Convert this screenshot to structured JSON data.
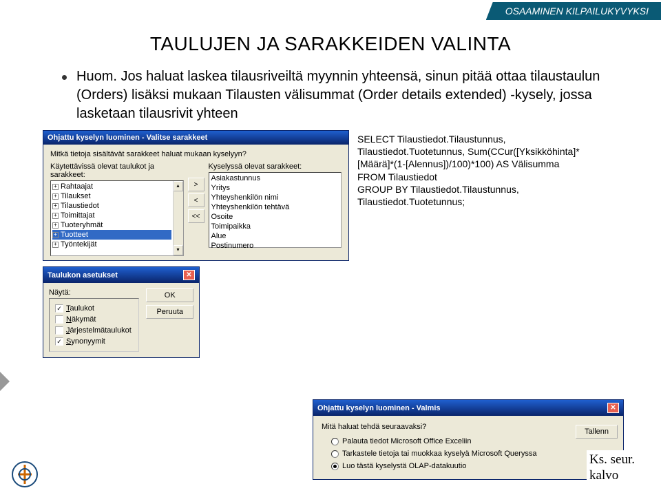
{
  "banner": "OSAAMINEN KILPAILUKYVYKSI",
  "title": "TAULUJEN JA SARAKKEIDEN VALINTA",
  "bullet": "Huom. Jos haluat laskea tilausriveiltä myynnin yhteensä, sinun pitää ottaa tilaustaulun (Orders) lisäksi mukaan Tilausten välisummat (Order details extended) -kysely, jossa lasketaan tilausrivit yhteen",
  "wizard1": {
    "title": "Ohjattu kyselyn luominen - Valitse sarakkeet",
    "desc": "Mitkä tietoja sisältävät sarakkeet haluat mukaan kyselyyn?",
    "leftLabel": "Käytettävissä olevat taulukot ja sarakkeet:",
    "rightLabel": "Kyselyssä olevat sarakkeet:",
    "leftItems": [
      "Rahtaajat",
      "Tilaukset",
      "Tilaustiedot",
      "Toimittajat",
      "Tuoteryhmät",
      "Tuotteet",
      "Työntekijät"
    ],
    "selectedLeft": "Tuotteet",
    "rightItems": [
      "Asiakastunnus",
      "Yritys",
      "Yhteyshenkilön nimi",
      "Yhteyshenkilön tehtävä",
      "Osoite",
      "Toimipaikka",
      "Alue",
      "Postinumero"
    ]
  },
  "dlg2": {
    "title": "Taulukon asetukset",
    "groupLabel": "Näytä:",
    "checks": [
      {
        "label": "Taulukot",
        "checked": true
      },
      {
        "label": "Näkymät",
        "checked": false
      },
      {
        "label": "Järjestelmätaulukot",
        "checked": false
      },
      {
        "label": "Synonyymit",
        "checked": true
      }
    ],
    "ok": "OK",
    "cancel": "Peruuta"
  },
  "sql": "SELECT Tilaustiedot.Tilaustunnus, Tilaustiedot.Tuotetunnus, Sum(CCur([Yksikköhinta]*[Määrä]*(1-[Alennus])/100)*100) AS Välisumma\nFROM Tilaustiedot\nGROUP BY Tilaustiedot.Tilaustunnus, Tilaustiedot.Tuotetunnus;",
  "wizard2": {
    "title": "Ohjattu kyselyn luominen - Valmis",
    "question": "Mitä haluat tehdä seuraavaksi?",
    "radios": [
      {
        "label": "Palauta tiedot Microsoft Office Exceliin",
        "sel": false
      },
      {
        "label": "Tarkastele tietoja tai muokkaa kyselyä Microsoft Queryssa",
        "sel": false
      },
      {
        "label": "Luo tästä kyselystä OLAP-datakuutio",
        "sel": true
      }
    ],
    "btn": "Tallenn"
  },
  "footer": {
    "l1": "Ks. seur.",
    "l2": "kalvo"
  }
}
